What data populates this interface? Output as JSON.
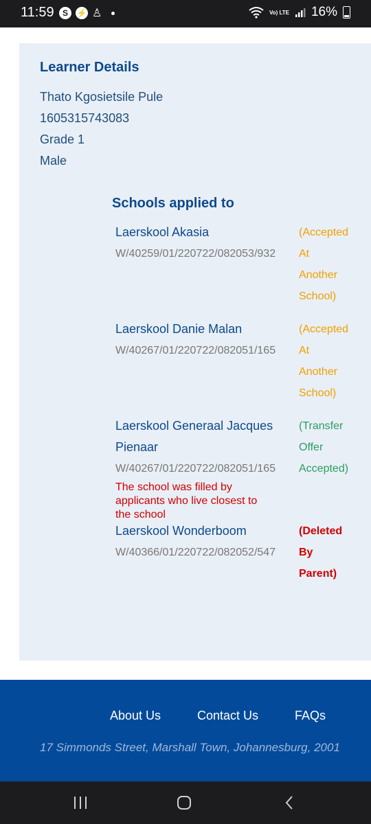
{
  "status_bar": {
    "time": "11:59",
    "left_icons": [
      "s-circle-icon",
      "flash-circle-icon",
      "notification-icon"
    ],
    "network": "Vo) LTE",
    "battery": "16%"
  },
  "learner": {
    "title": "Learner Details",
    "name": "Thato Kgosietsile Pule",
    "id_number": "1605315743083",
    "grade": "Grade 1",
    "gender": "Male"
  },
  "schools": {
    "title": "Schools applied to",
    "items": [
      {
        "name_lines": [
          "Laerskool Akasia"
        ],
        "ref": "W/40259/01/220722/082053/932",
        "status_lines": [
          "(Accepted",
          "At",
          "Another",
          "School)"
        ],
        "status_color": "#f0a000"
      },
      {
        "name_lines": [
          "Laerskool Danie Malan"
        ],
        "ref": "W/40267/01/220722/082051/165",
        "status_lines": [
          "(Accepted",
          "At",
          "Another",
          "School)"
        ],
        "status_color": "#f0a000"
      },
      {
        "name_lines": [
          "Laerskool Generaal Jacques",
          "Pienaar"
        ],
        "ref": "W/40267/01/220722/082051/165",
        "note_lines": [
          "The school was filled by",
          "applicants who live closest to",
          "the school"
        ],
        "status_lines": [
          "(Transfer",
          "Offer",
          "Accepted)"
        ],
        "status_color": "#2a9d62"
      },
      {
        "name_lines": [
          "Laerskool Wonderboom"
        ],
        "ref": "W/40366/01/220722/082052/547",
        "status_lines": [
          "(Deleted",
          "By",
          "Parent)"
        ],
        "status_color": "#d00000"
      }
    ]
  },
  "footer": {
    "links": [
      "About Us",
      "Contact Us",
      "FAQs"
    ],
    "address": "17 Simmonds Street, Marshall Town, Johannesburg, 2001"
  },
  "nav": {
    "icons": [
      "recent-apps-icon",
      "home-icon",
      "back-icon"
    ]
  }
}
